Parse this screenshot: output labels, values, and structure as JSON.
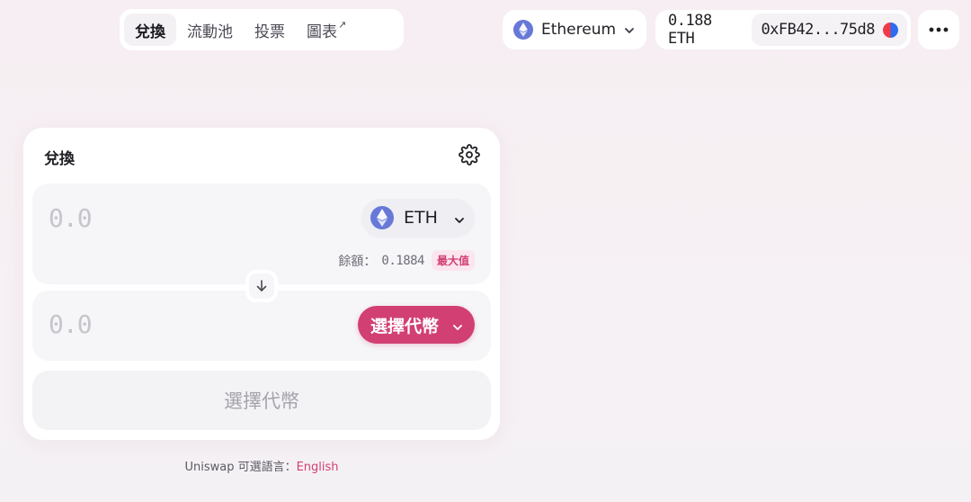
{
  "nav": {
    "items": [
      {
        "label": "兌換",
        "active": true
      },
      {
        "label": "流動池",
        "active": false
      },
      {
        "label": "投票",
        "active": false
      },
      {
        "label": "圖表",
        "active": false,
        "external": true
      }
    ],
    "external_glyph": "↗"
  },
  "network": {
    "label": "Ethereum",
    "icon": "ethereum-icon"
  },
  "account": {
    "balance": "0.188 ETH",
    "address": "0xFB42...75d8"
  },
  "more_menu": {
    "icon": "ellipsis-icon"
  },
  "swap_card": {
    "title": "兌換",
    "settings_icon": "gear-icon",
    "input": {
      "amount_placeholder": "0.0",
      "token_label": "ETH",
      "balance_label": "餘額：",
      "balance_value": "0.1884",
      "max_label": "最大值"
    },
    "output": {
      "amount_placeholder": "0.0",
      "select_label": "選擇代幣"
    },
    "action_label": "選擇代幣"
  },
  "footer": {
    "text": "Uniswap 可選語言：",
    "language": "English"
  },
  "colors": {
    "accent": "#d13f73",
    "eth": "#6778d8",
    "panel": "#f6f5f8"
  }
}
